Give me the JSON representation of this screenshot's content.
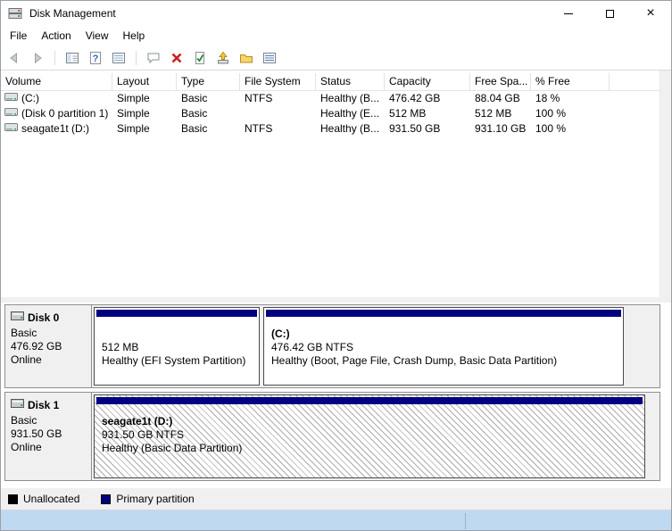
{
  "window": {
    "title": "Disk Management",
    "controls": {
      "close": "×"
    }
  },
  "menu": {
    "items": [
      "File",
      "Action",
      "View",
      "Help"
    ]
  },
  "toolbar": {
    "icons": [
      "back",
      "forward",
      "show-hide-console-tree",
      "help",
      "export-list",
      "action-pane",
      "delete-volume",
      "check-document",
      "activate-up-arrow",
      "open-folder",
      "list-view"
    ]
  },
  "volume_list": {
    "columns": [
      "Volume",
      "Layout",
      "Type",
      "File System",
      "Status",
      "Capacity",
      "Free Spa...",
      "% Free"
    ],
    "rows": [
      {
        "volume": "(C:)",
        "layout": "Simple",
        "type": "Basic",
        "file_system": "NTFS",
        "status": "Healthy (B...",
        "capacity": "476.42 GB",
        "free_space": "88.04 GB",
        "pct_free": "18 %"
      },
      {
        "volume": "(Disk 0 partition 1)",
        "layout": "Simple",
        "type": "Basic",
        "file_system": "",
        "status": "Healthy (E...",
        "capacity": "512 MB",
        "free_space": "512 MB",
        "pct_free": "100 %"
      },
      {
        "volume": "seagate1t (D:)",
        "layout": "Simple",
        "type": "Basic",
        "file_system": "NTFS",
        "status": "Healthy (B...",
        "capacity": "931.50 GB",
        "free_space": "931.10 GB",
        "pct_free": "100 %"
      }
    ]
  },
  "graphical_view": {
    "disks": [
      {
        "name": "Disk 0",
        "type": "Basic",
        "size": "476.92 GB",
        "status": "Online",
        "partitions": [
          {
            "label": "",
            "size_line": "512 MB",
            "status_line": "Healthy (EFI System Partition)"
          },
          {
            "label": "(C:)",
            "size_line": "476.42 GB NTFS",
            "status_line": "Healthy (Boot, Page File, Crash Dump, Basic Data Partition)"
          }
        ]
      },
      {
        "name": "Disk 1",
        "type": "Basic",
        "size": "931.50 GB",
        "status": "Online",
        "partitions": [
          {
            "label": "seagate1t  (D:)",
            "size_line": "931.50 GB NTFS",
            "status_line": "Healthy (Basic Data Partition)"
          }
        ]
      }
    ]
  },
  "legend": {
    "items": [
      {
        "label": "Unallocated",
        "color": "#000000"
      },
      {
        "label": "Primary partition",
        "color": "#000080"
      }
    ]
  },
  "colors": {
    "partition_header": "#000080",
    "status_bar": "#bfd9f0",
    "hatch_line": "#ababab"
  }
}
